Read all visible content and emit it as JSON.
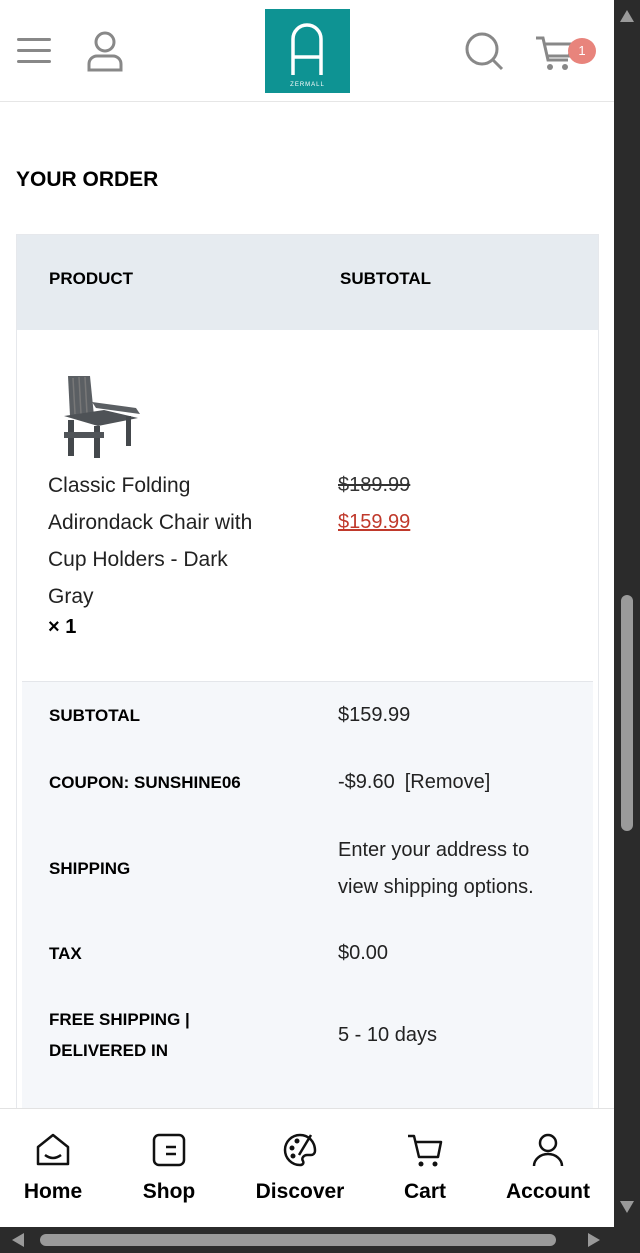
{
  "header": {
    "logo_text": "ZERMALL",
    "cart_count": "1"
  },
  "order": {
    "title": "YOUR ORDER",
    "col_product": "PRODUCT",
    "col_subtotal": "SUBTOTAL",
    "item": {
      "name": "Classic Folding Adirondack Chair with Cup Holders - Dark Gray",
      "qty": "× 1",
      "price_original": "$189.99",
      "price_sale": "$159.99"
    },
    "rows": {
      "subtotal_label": "SUBTOTAL",
      "subtotal_value": "$159.99",
      "coupon_label": "COUPON: SUNSHINE06",
      "coupon_value": "-$9.60",
      "coupon_remove": "[Remove]",
      "shipping_label": "SHIPPING",
      "shipping_value": "Enter your address to view shipping options.",
      "tax_label": "TAX",
      "tax_value": "$0.00",
      "delivery_label": "FREE SHIPPING | DELIVERED IN",
      "delivery_value": "5 - 10 days"
    }
  },
  "bottom_nav": {
    "home": "Home",
    "shop": "Shop",
    "discover": "Discover",
    "cart": "Cart",
    "account": "Account"
  },
  "colors": {
    "brand": "#0e9393",
    "badge": "#e8847c",
    "sale_price": "#c0392b"
  }
}
